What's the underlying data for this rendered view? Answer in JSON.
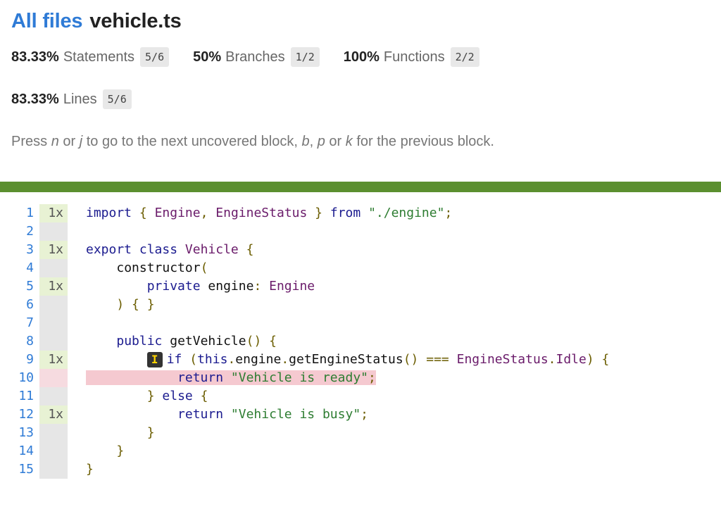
{
  "breadcrumb": {
    "all_files_label": "All files",
    "file_name": "vehicle.ts"
  },
  "stats": {
    "statements": {
      "pct": "83.33%",
      "label": "Statements",
      "fraction": "5/6"
    },
    "branches": {
      "pct": "50%",
      "label": "Branches",
      "fraction": "1/2"
    },
    "functions": {
      "pct": "100%",
      "label": "Functions",
      "fraction": "2/2"
    },
    "lines": {
      "pct": "83.33%",
      "label": "Lines",
      "fraction": "5/6"
    }
  },
  "hint": {
    "p1": "Press ",
    "k1": "n",
    "p2": " or ",
    "k2": "j",
    "p3": " to go to the next uncovered block, ",
    "k3": "b",
    "p4": ", ",
    "k4": "p",
    "p5": " or ",
    "k5": "k",
    "p6": " for the previous block."
  },
  "colors": {
    "status_bar": "#5b8f2f",
    "link": "#2f7bd6",
    "uncovered": "#f5c9d0",
    "covered": "#e8f2d4"
  },
  "code": {
    "line_numbers": [
      "1",
      "2",
      "3",
      "4",
      "5",
      "6",
      "7",
      "8",
      "9",
      "10",
      "11",
      "12",
      "13",
      "14",
      "15"
    ],
    "hit_counts": [
      "1x",
      "",
      "1x",
      "",
      "1x",
      "",
      "",
      "",
      "1x",
      "",
      "",
      "1x",
      "",
      "",
      ""
    ],
    "if_marker": "I",
    "tokens": {
      "import": "import",
      "lbrace": "{",
      "engine_type": "Engine",
      "comma": ",",
      "engine_status_type": "EngineStatus",
      "rbrace": "}",
      "from": "from",
      "engine_path": "\"./engine\"",
      "semi": ";",
      "export": "export",
      "class": "class",
      "vehicle_class": "Vehicle",
      "constructor": "constructor",
      "lparen": "(",
      "private": "private",
      "engine_param": "engine",
      "colon": ":",
      "rparen_brace": ") { }",
      "public": "public",
      "get_vehicle": "getVehicle",
      "parens": "()",
      "if": "if",
      "paren_open": "(",
      "this": "this",
      "dot": ".",
      "engine_ref": "engine",
      "get_engine_status": "getEngineStatus",
      "strict_eq": "===",
      "engine_status_ref": "EngineStatus",
      "idle": "Idle",
      "paren_close": ")",
      "return": "return",
      "ready_str": "\"Vehicle is ready\"",
      "else": "else",
      "busy_str": "\"Vehicle is busy\""
    }
  }
}
